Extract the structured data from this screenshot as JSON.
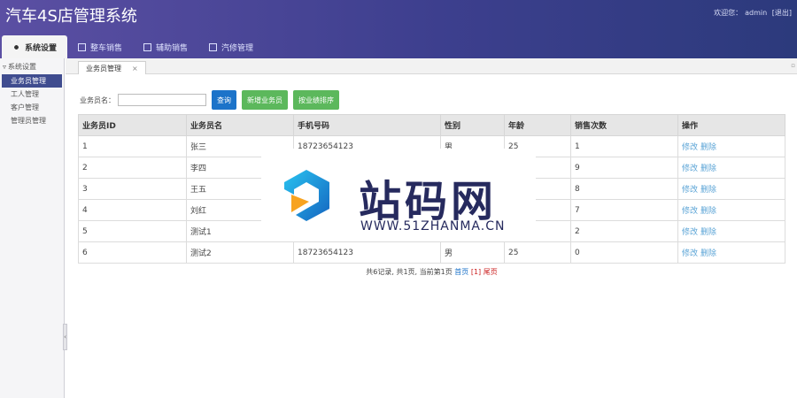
{
  "app": {
    "title": "汽车4S店管理系统"
  },
  "userbar": {
    "greeting": "欢迎您：",
    "username": "admin",
    "logout": "[退出]"
  },
  "topnav": {
    "tabs": [
      {
        "label": "系统设置",
        "active": true
      },
      {
        "label": "整车销售"
      },
      {
        "label": "辅助销售"
      },
      {
        "label": "汽修管理"
      }
    ]
  },
  "sidebar": {
    "section_title": "系统设置",
    "items": [
      {
        "label": "业务员管理",
        "active": true
      },
      {
        "label": "工人管理"
      },
      {
        "label": "客户管理"
      },
      {
        "label": "管理员管理"
      }
    ]
  },
  "page_tab": {
    "label": "业务员管理",
    "close": "×"
  },
  "search": {
    "label": "业务员名：",
    "value": "",
    "placeholder": "",
    "query_button": "查询",
    "add_button": "新增业务员",
    "sort_button": "按业绩排序"
  },
  "table": {
    "headers": [
      "业务员ID",
      "业务员名",
      "手机号码",
      "性别",
      "年龄",
      "销售次数",
      "操作"
    ],
    "rows": [
      {
        "id": "1",
        "name": "张三",
        "phone": "18723654123",
        "gender": "男",
        "age": "25",
        "sales": "1"
      },
      {
        "id": "2",
        "name": "李四",
        "phone": "",
        "gender": "",
        "age": "",
        "sales": "9"
      },
      {
        "id": "3",
        "name": "王五",
        "phone": "",
        "gender": "",
        "age": "",
        "sales": "8"
      },
      {
        "id": "4",
        "name": "刘红",
        "phone": "",
        "gender": "",
        "age": "",
        "sales": "7"
      },
      {
        "id": "5",
        "name": "测试1",
        "phone": "",
        "gender": "",
        "age": "",
        "sales": "2"
      },
      {
        "id": "6",
        "name": "测试2",
        "phone": "18723654123",
        "gender": "男",
        "age": "25",
        "sales": "0"
      }
    ],
    "edit_label": "修改",
    "delete_label": "删除"
  },
  "pager": {
    "summary": "共6记录, 共1页, 当前第1页",
    "first": "首页",
    "current": "[1]",
    "last": "尾页"
  },
  "watermark": {
    "text": "站码网",
    "url": "WWW.51ZHANMA.CN"
  },
  "colors": {
    "header": "#3d3f8e",
    "primary": "#1c73c9",
    "success": "#5cb85c",
    "link": "#5ba4d6"
  }
}
